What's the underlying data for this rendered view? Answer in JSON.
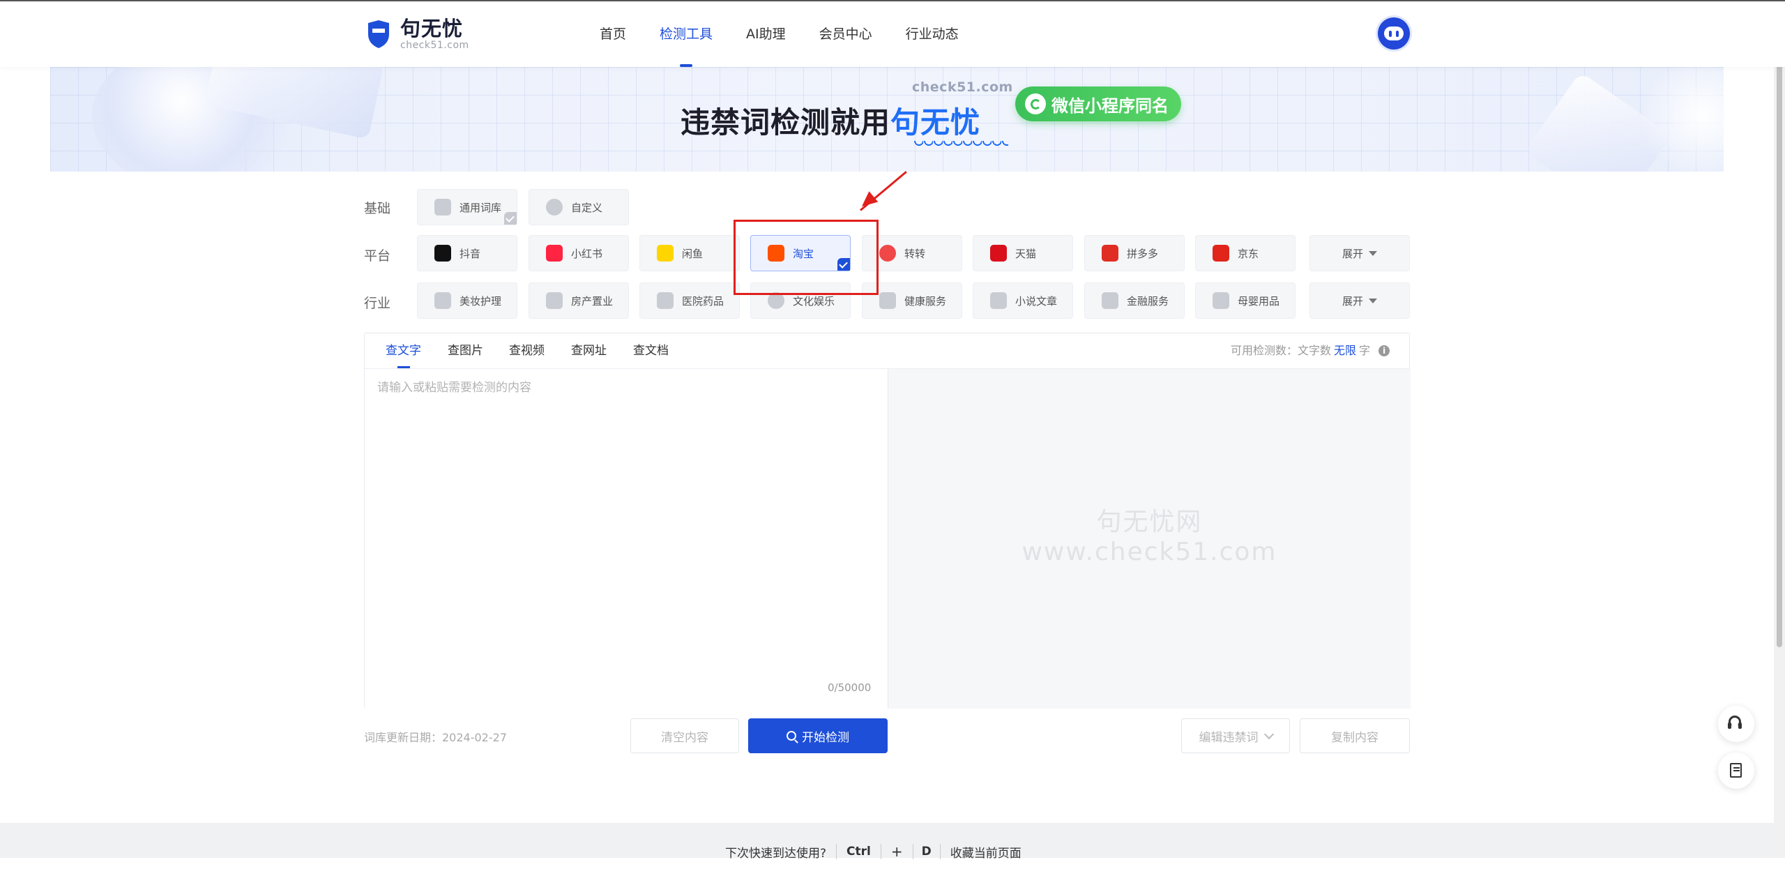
{
  "header": {
    "logo_name": "句无忧",
    "logo_sub": "check51.com",
    "nav": [
      "首页",
      "检测工具",
      "AI助理",
      "会员中心",
      "行业动态"
    ],
    "active_nav": "检测工具"
  },
  "banner": {
    "url_text": "check51.com",
    "headline": "违禁词检测就用",
    "brand": "句无忧",
    "pill": "微信小程序同名"
  },
  "filters": {
    "basic_label": "基础",
    "basic": [
      {
        "label": "通用词库",
        "icon": "library-icon",
        "checked": true
      },
      {
        "label": "自定义",
        "icon": "user-settings-icon",
        "checked": false
      }
    ],
    "platform_label": "平台",
    "platforms": [
      {
        "label": "抖音",
        "icon": "douyin-icon",
        "color": "#111111"
      },
      {
        "label": "小红书",
        "icon": "xiaohongshu-icon",
        "color": "#ff2442"
      },
      {
        "label": "闲鱼",
        "icon": "xianyu-icon",
        "color": "#ffd500"
      },
      {
        "label": "淘宝",
        "icon": "taobao-icon",
        "color": "#ff5000",
        "selected": true
      },
      {
        "label": "转转",
        "icon": "zhuanzhuan-icon",
        "color": "#f04848"
      },
      {
        "label": "天猫",
        "icon": "tmall-icon",
        "color": "#d9101c"
      },
      {
        "label": "拼多多",
        "icon": "pinduoduo-icon",
        "color": "#e02e24"
      },
      {
        "label": "京东",
        "icon": "jd-icon",
        "color": "#e1251b"
      }
    ],
    "industry_label": "行业",
    "industries": [
      {
        "label": "美妆护理",
        "icon": "cosmetics-icon"
      },
      {
        "label": "房产置业",
        "icon": "building-icon"
      },
      {
        "label": "医院药品",
        "icon": "hospital-icon"
      },
      {
        "label": "文化娱乐",
        "icon": "entertainment-icon"
      },
      {
        "label": "健康服务",
        "icon": "health-icon"
      },
      {
        "label": "小说文章",
        "icon": "book-icon"
      },
      {
        "label": "金融服务",
        "icon": "finance-icon"
      },
      {
        "label": "母婴用品",
        "icon": "baby-bottle-icon"
      }
    ],
    "expand_label": "展开"
  },
  "panel": {
    "tabs": [
      "查文字",
      "查图片",
      "查视频",
      "查网址",
      "查文档"
    ],
    "active_tab": "查文字",
    "quota_label": "可用检测数：文字数",
    "quota_value": "无限",
    "quota_unit": "字",
    "placeholder": "请输入或粘贴需要检测的内容",
    "counter": "0/50000",
    "watermark_line1": "句无忧网",
    "watermark_line2": "www.check51.com"
  },
  "actions": {
    "update_date": "词库更新日期：2024-02-27",
    "clear": "清空内容",
    "start": "开始检测",
    "edit": "编辑违禁词",
    "copy": "复制内容"
  },
  "bottom_bar": {
    "prompt": "下次快速到达使用?",
    "key_ctrl": "Ctrl",
    "plus": "+",
    "key_d": "D",
    "bookmark": "收藏当前页面"
  }
}
